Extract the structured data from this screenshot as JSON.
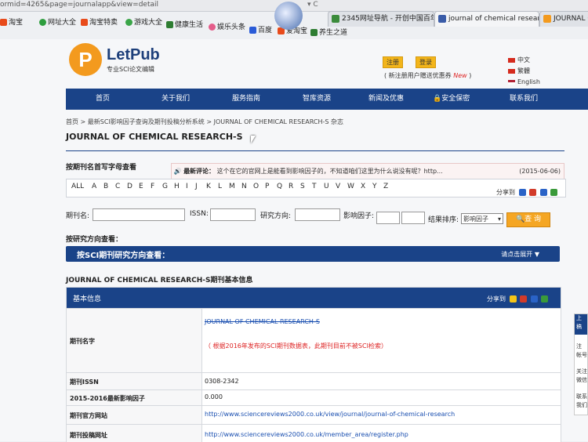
{
  "browser": {
    "url_fragment": "ormid=4265&page=journalapp&view=detail",
    "tabs": [
      {
        "label": "2345网址导航 - 开创中国百年..."
      },
      {
        "label": "journal of chemical research..."
      },
      {
        "label": "JOURNAL OF"
      }
    ],
    "bookmarks": [
      "淘宝",
      "网址大全",
      "淘宝特卖",
      "游戏大全",
      "健康生活",
      "娱乐头条",
      "百度",
      "爱淘宝",
      "养生之道"
    ]
  },
  "header": {
    "logo_name": "LetPub",
    "logo_letter": "P",
    "logo_sub": "专业SCI论文编辑",
    "register_label": "注册",
    "login_label": "登录",
    "promo_text": "( 新注册用户赠送优惠券",
    "promo_new": "New",
    "promo_close": ")",
    "languages": [
      "中文",
      "繁體",
      "English"
    ]
  },
  "nav": {
    "items": [
      "首页",
      "关于我们",
      "服务指南",
      "智库资源",
      "新闻及优惠",
      "安全保密",
      "联系我们"
    ]
  },
  "breadcrumb": "首页 > 最新SCI影响因子查询及期刊投稿分析系统 > JOURNAL OF CHEMICAL RESEARCH-S 杂志",
  "journal_title": "JOURNAL OF CHEMICAL RESEARCH-S",
  "browse": {
    "heading": "按期刊名首写字母查看",
    "notice_label": "最新评论：",
    "notice_text": "这个在它的官网上是能看到影响因子的，不知道咱们这里为什么说没有呢？http...",
    "notice_date": "(2015-06-06)",
    "letters": [
      "ALL",
      "A",
      "B",
      "C",
      "D",
      "E",
      "F",
      "G",
      "H",
      "I",
      "J",
      "K",
      "L",
      "M",
      "N",
      "O",
      "P",
      "Q",
      "R",
      "S",
      "T",
      "U",
      "V",
      "W",
      "X",
      "Y",
      "Z"
    ],
    "share_label": "分享到"
  },
  "filters": {
    "name_label": "期刊名:",
    "issn_label": "ISSN:",
    "direction_label": "研究方向:",
    "if_label": "影响因子:",
    "sort_label": "结果排序:",
    "sort_value": "影响因子",
    "search_label": "查 询"
  },
  "direction": {
    "heading": "按研究方向查看：",
    "bar_label": "按SCI期刊研究方向查看：",
    "expand_label": "请点击展开 ▼"
  },
  "info": {
    "heading": "JOURNAL OF CHEMICAL RESEARCH-S期刊基本信息",
    "table_title": "基本信息",
    "share_label": "分享到",
    "rows": [
      {
        "label": "期刊名字",
        "value": "JOURNAL OF CHEMICAL RESEARCH-S",
        "note": "（ 根据2016年发布的SCI期刊数据表，此期刊目前不被SCI检索）"
      },
      {
        "label": "期刊ISSN",
        "value": "0308-2342"
      },
      {
        "label": "2015-2016最新影响因子",
        "value": "0.000"
      },
      {
        "label": "期刊官方网站",
        "value": "http://www.sciencereviews2000.co.uk/view/journal/journal-of-chemical-research"
      },
      {
        "label": "期刊投稿网址",
        "value": "http://www.sciencereviews2000.co.uk/member_area/register.php"
      }
    ]
  },
  "sidebar": {
    "items": [
      "上",
      "稿",
      "注",
      "帐号",
      "关注",
      "微信",
      "联系",
      "我们"
    ]
  },
  "colors": {
    "brand_blue": "#1a4388",
    "logo_orange": "#f39a1e",
    "link_blue": "#1a4fb0",
    "alert_red": "#dd2222"
  }
}
